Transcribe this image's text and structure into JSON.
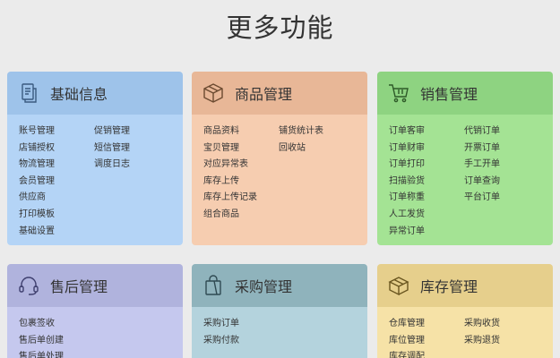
{
  "page": {
    "title": "更多功能"
  },
  "cards": [
    {
      "title": "基础信息",
      "icon": "document-icon",
      "col1": [
        "账号管理",
        "店铺授权",
        "物流管理",
        "会员管理",
        "供应商",
        "打印模板",
        "基础设置"
      ],
      "col2": [
        "促销管理",
        "短信管理",
        "调度日志"
      ]
    },
    {
      "title": "商品管理",
      "icon": "box-icon",
      "col1": [
        "商品资料",
        "宝贝管理",
        "对应异常表",
        "库存上传",
        "库存上传记录",
        "组合商品"
      ],
      "col2": [
        "铺货统计表",
        "回收站"
      ]
    },
    {
      "title": "销售管理",
      "icon": "cart-icon",
      "col1": [
        "订单客审",
        "订单财审",
        "订单打印",
        "扫描验货",
        "订单称重",
        "人工发货",
        "异常订单"
      ],
      "col2": [
        "代销订单",
        "开票订单",
        "手工开单",
        "订单查询",
        "平台订单"
      ]
    },
    {
      "title": "售后管理",
      "icon": "headset-icon",
      "col1": [
        "包裹签收",
        "售后单创建",
        "售后单处理"
      ],
      "col2": []
    },
    {
      "title": "采购管理",
      "icon": "shopping-bag-icon",
      "col1": [
        "采购订单",
        "采购付款"
      ],
      "col2": []
    },
    {
      "title": "库存管理",
      "icon": "warehouse-icon",
      "col1": [
        "仓库管理",
        "库位管理",
        "库存调配"
      ],
      "col2": [
        "采购收货",
        "采购退货"
      ]
    }
  ]
}
